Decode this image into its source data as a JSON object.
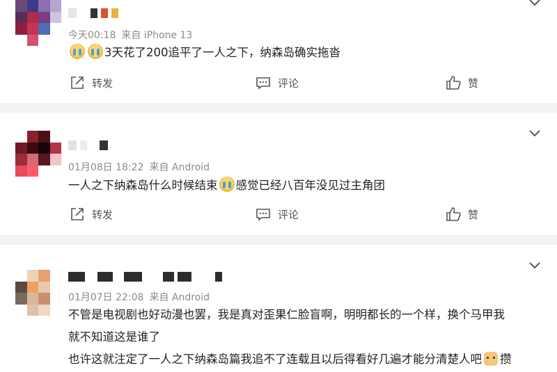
{
  "posts": [
    {
      "meta_time": "今天00:18",
      "meta_source": "来自 iPhone 13",
      "text_after_emoji": "3天花了200追平了一人之下，纳森岛确实拖沓",
      "repost_label": "转发",
      "comment_label": "评论",
      "like_label": "赞"
    },
    {
      "meta_time": "01月08日 18:22",
      "meta_source": "来自 Android",
      "text_before_emoji": "一人之下纳森岛什么时候结束",
      "text_after_emoji": "感觉已经八百年没见过主角团",
      "repost_label": "转发",
      "comment_label": "评论",
      "like_label": "赞"
    },
    {
      "meta_time": "01月07日 22:08",
      "meta_source": "来自 Android",
      "line1": "不管是电视剧也好动漫也罢，我是真对歪果仁脸盲啊，明明都长的一个样，换个马甲我",
      "line2": "就不知道这是谁了",
      "line3": "也许这就注定了一人之下纳森岛篇我追不了连载且以后得看好几遍才能分清楚人吧",
      "line3_tail": "攒"
    }
  ],
  "colors": {
    "separator": "#f2f2f2",
    "meta_text": "#8a8a8a",
    "action_text": "#555555"
  },
  "icons": [
    "repost-icon",
    "comment-icon",
    "like-icon",
    "chevron-down-icon",
    "crying-emoji-icon",
    "doge-emoji-icon"
  ]
}
